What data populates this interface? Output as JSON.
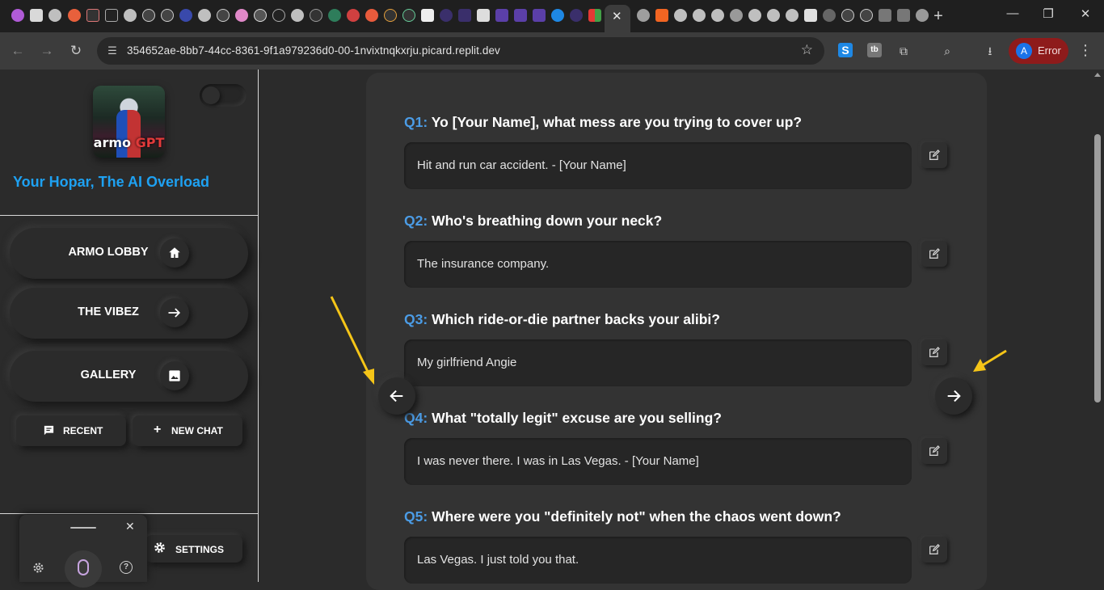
{
  "browser": {
    "tab_close_glyph": "✕",
    "new_tab_glyph": "+",
    "window_controls": [
      "—",
      "❐",
      "✕"
    ],
    "url": "354652ae-8bb7-44cc-8361-9f1a979236d0-00-1nvixtnqkxrju.picard.replit.dev",
    "profile_initial": "A",
    "profile_status": "Error",
    "nav": {
      "back": "←",
      "forward": "→",
      "reload": "↻"
    }
  },
  "sidebar": {
    "logo_text_a": "armo",
    "logo_text_b": "GPT",
    "brand_title": "Your Hopar, The AI Overload",
    "nav_items": [
      {
        "label": "ARMO LOBBY",
        "icon": "home-icon",
        "glyph": "⌂"
      },
      {
        "label": "THE VIBEZ",
        "icon": "arrow-right-icon",
        "glyph": "→"
      },
      {
        "label": "GALLERY",
        "icon": "image-icon",
        "glyph": "▨"
      }
    ],
    "recent_label": "RECENT",
    "new_chat_label": "NEW CHAT",
    "settings_label": "SETTINGS"
  },
  "voice_widget": {
    "close_glyph": "✕",
    "help_glyph": "?"
  },
  "questions": [
    {
      "num": "Q1:",
      "text": "Yo [Your Name], what mess are you trying to cover up?",
      "answer": "Hit and run car accident. - [Your Name]"
    },
    {
      "num": "Q2:",
      "text": "Who's breathing down your neck?",
      "answer": "The insurance company."
    },
    {
      "num": "Q3:",
      "text": "Which ride-or-die partner backs your alibi?",
      "answer": "My girlfriend Angie"
    },
    {
      "num": "Q4:",
      "text": "What \"totally legit\" excuse are you selling?",
      "answer": "I was never there. I was in Las Vegas. - [Your Name]"
    },
    {
      "num": "Q5:",
      "text": "Where were you \"definitely not\" when the chaos went down?",
      "answer": "Las Vegas. I just told you that."
    }
  ],
  "colors": {
    "accent": "#4b9ce6",
    "brand_blue": "#1ea1f2",
    "annotation_arrow": "#f5c518",
    "profile_error": "#8e1b1b"
  }
}
